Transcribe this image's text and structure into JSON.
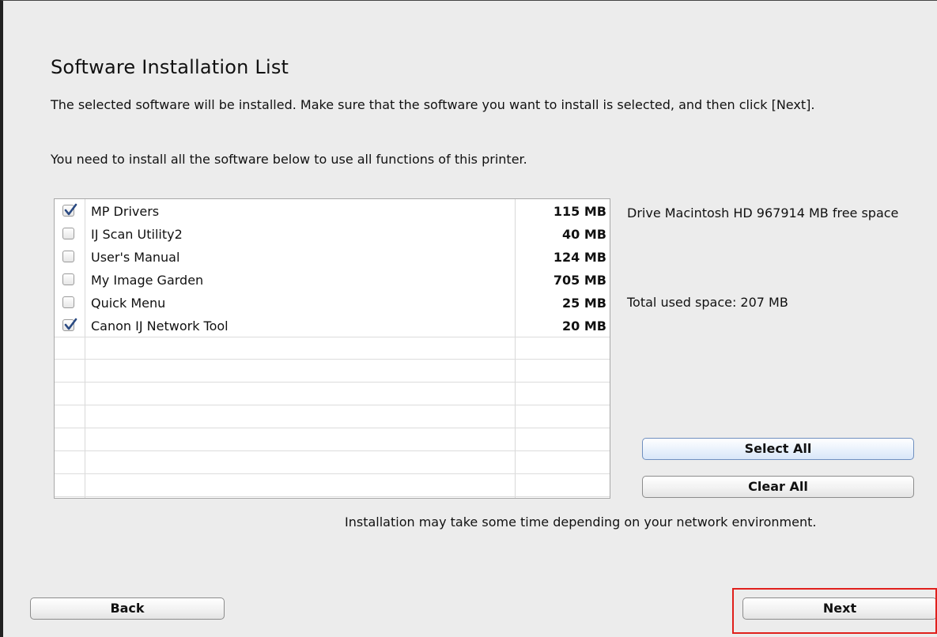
{
  "title": "Software Installation List",
  "instructions": "The selected software will be installed. Make sure that the software you want to install is selected, and then click [Next].",
  "subtext": "You need to install all the software below to use all functions of this printer.",
  "software_list": {
    "items": [
      {
        "name": "MP Drivers",
        "size": "115 MB",
        "checked": true
      },
      {
        "name": "IJ Scan Utility2",
        "size": "40 MB",
        "checked": false
      },
      {
        "name": "User's Manual",
        "size": "124 MB",
        "checked": false
      },
      {
        "name": "My Image Garden",
        "size": "705 MB",
        "checked": false
      },
      {
        "name": "Quick Menu",
        "size": "25 MB",
        "checked": false
      },
      {
        "name": "Canon IJ Network Tool",
        "size": "20 MB",
        "checked": true
      }
    ]
  },
  "disk_info": {
    "free_space": "Drive Macintosh HD 967914 MB free space",
    "total_used": "Total used space: 207 MB"
  },
  "buttons": {
    "select_all": "Select All",
    "clear_all": "Clear All",
    "back": "Back",
    "next": "Next"
  },
  "note": "Installation may take some time depending on your network environment.",
  "colors": {
    "check_mark": "#2a4a82",
    "highlight": "#e0201c"
  }
}
